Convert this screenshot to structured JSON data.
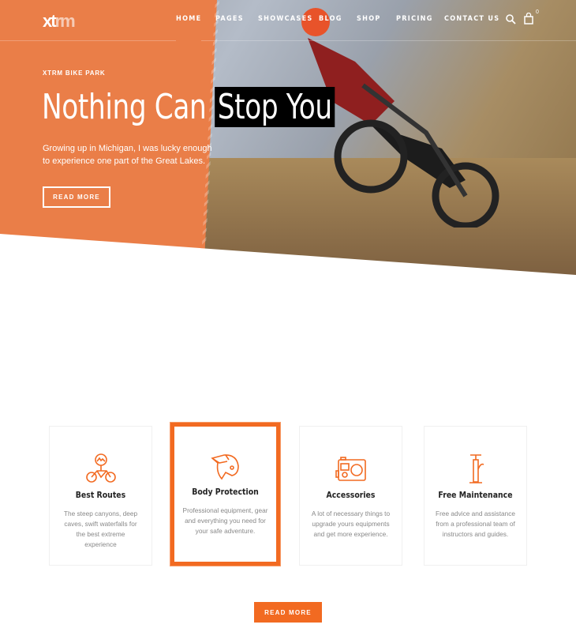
{
  "brand": {
    "logo_text": "xtrm",
    "accent": "#f26a21",
    "hero_orange": "#ea7e48"
  },
  "nav": {
    "items": [
      {
        "label": "HOME",
        "active": true
      },
      {
        "label": "PAGES"
      },
      {
        "label": "SHOWCASES"
      },
      {
        "label": "BLOG"
      },
      {
        "label": "SHOP"
      },
      {
        "label": "PRICING"
      },
      {
        "label": "CONTACT US"
      }
    ],
    "cart_count": "0",
    "icons": [
      "search-icon",
      "cart-bag-icon"
    ]
  },
  "hero": {
    "eyebrow": "XTRM BIKE PARK",
    "title_plain": "Nothing Can",
    "title_highlight": "Stop You",
    "lead": "Growing up in Michigan, I was lucky enough to experience one part of the Great Lakes.",
    "button": "READ MORE"
  },
  "features": [
    {
      "icon": "bike-route-icon",
      "title": "Best Routes",
      "text": "The steep canyons, deep caves, swift waterfalls for the best extreme experience"
    },
    {
      "icon": "helmet-icon",
      "title": "Body Protection",
      "text": "Professional equipment, gear and everything you need for your safe adventure.",
      "highlighted": true
    },
    {
      "icon": "action-camera-icon",
      "title": "Accessories",
      "text": "A lot of necessary things to upgrade yours equipments and get more experience."
    },
    {
      "icon": "bike-pump-icon",
      "title": "Free Maintenance",
      "text": "Free advice and assistance from a professional team of instructors and guides."
    }
  ],
  "cta": {
    "button": "READ MORE"
  }
}
